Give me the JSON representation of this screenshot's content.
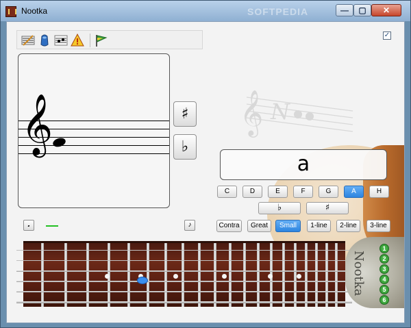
{
  "window": {
    "title": "Nootka",
    "watermark": "SOFTPEDIA"
  },
  "titlebar_controls": {
    "minimize": "—",
    "maximize": "▢",
    "close": "✕"
  },
  "toolbar": {
    "items": [
      {
        "icon": "settings-icon"
      },
      {
        "icon": "level-icon"
      },
      {
        "icon": "score-icon"
      },
      {
        "icon": "exam-icon"
      },
      {
        "icon": "about-flag-icon"
      }
    ]
  },
  "checkbox": {
    "checked": true,
    "mark": "✓"
  },
  "score": {
    "clef": "𝄞",
    "note": "a"
  },
  "accidentals": {
    "sharp": "♯",
    "flat": "♭"
  },
  "score_tools": {
    "left_icon": "tuning-fork-icon",
    "left_glyph": "𝅘",
    "right_icon": "note-icon",
    "right_glyph": "♪"
  },
  "note_name": {
    "value": "a"
  },
  "note_buttons": [
    {
      "label": "C",
      "active": false
    },
    {
      "label": "D",
      "active": false
    },
    {
      "label": "E",
      "active": false
    },
    {
      "label": "F",
      "active": false
    },
    {
      "label": "G",
      "active": false
    },
    {
      "label": "A",
      "active": true
    },
    {
      "label": "H",
      "active": false
    }
  ],
  "accidental_buttons": {
    "flat": "♭",
    "sharp": "♯"
  },
  "octave_buttons": [
    {
      "label": "Contra",
      "active": false
    },
    {
      "label": "Great",
      "active": false
    },
    {
      "label": "Small",
      "active": true
    },
    {
      "label": "1-line",
      "active": false
    },
    {
      "label": "2-line",
      "active": false
    },
    {
      "label": "3-line",
      "active": false
    }
  ],
  "guitar": {
    "strings": [
      "1",
      "2",
      "3",
      "4",
      "5",
      "6"
    ],
    "selected_string": 4,
    "selected_fret": 7,
    "headstock_text": "Nootka"
  },
  "colors": {
    "accent": "#2c84e0",
    "string_marker": "#2a8a2a",
    "finger_mark": "#3a8ff0"
  }
}
